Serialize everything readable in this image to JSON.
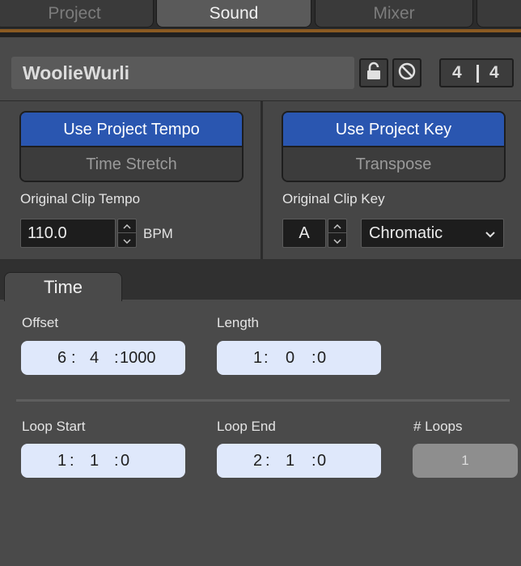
{
  "tabs": [
    {
      "label": "Project",
      "active": false
    },
    {
      "label": "Sound",
      "active": true
    },
    {
      "label": "Mixer",
      "active": false
    }
  ],
  "clip": {
    "name": "WoolieWurli",
    "lock_icon": "lock-icon",
    "disable_icon": "no-entry-icon",
    "time_signature": {
      "numerator": "4",
      "denominator": "4"
    }
  },
  "tempo": {
    "use_label": "Use Project Tempo",
    "mode_label": "Time Stretch",
    "original_label": "Original Clip Tempo",
    "value": "110.0",
    "unit": "BPM"
  },
  "key": {
    "use_label": "Use Project Key",
    "mode_label": "Transpose",
    "original_label": "Original Clip Key",
    "value": "A",
    "scale": "Chromatic"
  },
  "time_tab": {
    "label": "Time"
  },
  "time": {
    "offset": {
      "label": "Offset",
      "bar": "6",
      "beat": "4",
      "tick": "1000"
    },
    "length": {
      "label": "Length",
      "bar": "1",
      "beat": "0",
      "tick": "0"
    },
    "loop_start": {
      "label": "Loop Start",
      "bar": "1",
      "beat": "1",
      "tick": "0"
    },
    "loop_end": {
      "label": "Loop End",
      "bar": "2",
      "beat": "1",
      "tick": "0"
    },
    "loops": {
      "label": "# Loops",
      "value": "1"
    }
  },
  "colors": {
    "accent_blue": "#2a56b0",
    "tab_underline": "#8a5a22",
    "field_bg": "#dfe8fb"
  }
}
